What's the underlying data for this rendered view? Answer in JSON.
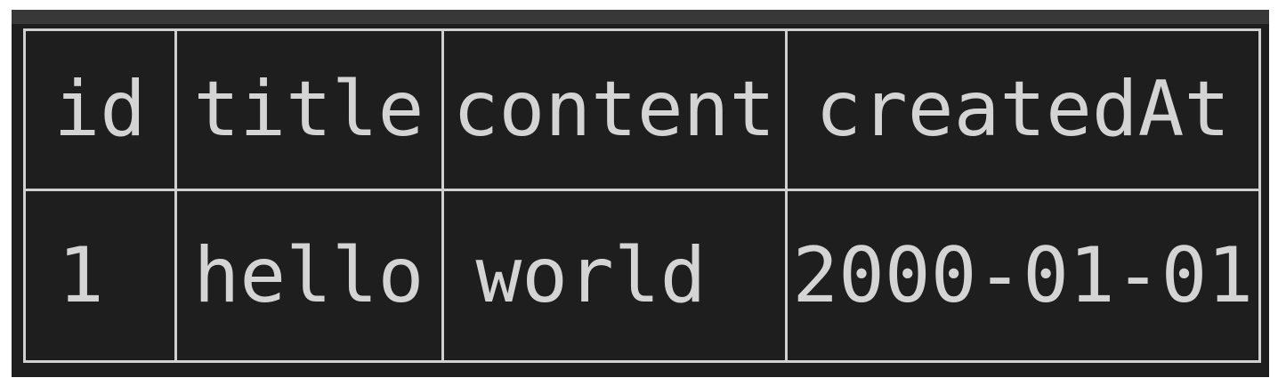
{
  "table": {
    "columns": [
      "id",
      "title",
      "content",
      "createdAt"
    ],
    "rows": [
      [
        "1",
        "hello",
        "world",
        "2000-01-01"
      ]
    ]
  },
  "colors": {
    "background": "#1e1e1e",
    "topbar": "#383838",
    "border": "#d0d0d0",
    "text": "#d4d4d4"
  }
}
